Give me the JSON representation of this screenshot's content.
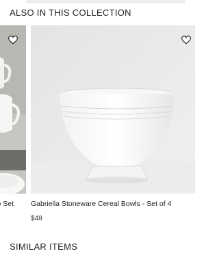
{
  "sections": {
    "collection_title": "ALSO IN THIS COLLECTION",
    "similar_title": "SIMILAR ITEMS"
  },
  "products": [
    {
      "name": "o Set",
      "icon": "heart-icon"
    },
    {
      "name": "Gabriella Stoneware Cereal Bowls - Set of 4",
      "price": "$48",
      "icon": "heart-icon"
    }
  ],
  "colors": {
    "text": "#222222",
    "tile_background": "#e9e9e7",
    "strip": "#ececec"
  }
}
